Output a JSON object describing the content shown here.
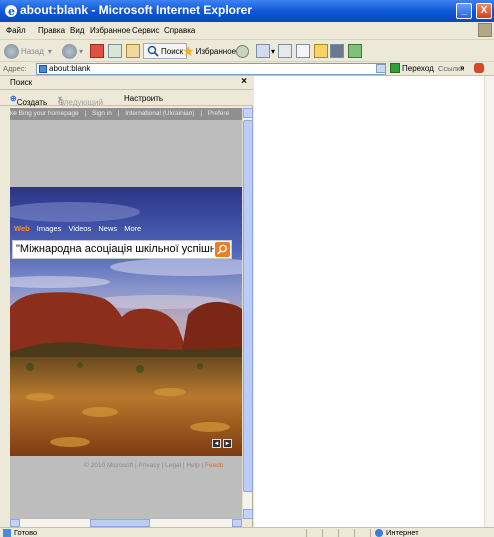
{
  "window": {
    "title": "about:blank - Microsoft Internet Explorer",
    "controls": {
      "minimize": "_",
      "maximize": "□",
      "close": "X"
    }
  },
  "menu": [
    "Файл",
    "Правка",
    "Вид",
    "Избранное",
    "Сервис",
    "Справка"
  ],
  "toolbar": {
    "back_label": "Назад",
    "search_label": "Поиск",
    "favorites_label": "Избранное",
    "icons": [
      "back-icon",
      "forward-icon",
      "stop-icon",
      "refresh-icon",
      "home-icon",
      "search-icon",
      "favorites-icon",
      "history-icon",
      "mail-icon",
      "print-icon",
      "edit-icon",
      "folder-icon",
      "messenger-icon"
    ]
  },
  "address": {
    "label": "Адрес:",
    "value": "about:blank",
    "go_label": "Переход",
    "links_label": "Ссылки",
    "chevron": "»"
  },
  "search_pane": {
    "title": "Поиск",
    "close": "×",
    "create_label": "Создать",
    "next_label": "Следующий",
    "customize_label": "Настроить",
    "bing": {
      "top_links": [
        "ke Bing your homepage",
        "|",
        "Sign in",
        "|",
        "International (Ukrainian)",
        "|",
        "Prefere"
      ],
      "nav": [
        "Web",
        "Images",
        "Videos",
        "News",
        "More"
      ],
      "query": "\"Міжнародна асоціація шкільної успішнос",
      "image_controls": [
        "◄",
        "►"
      ],
      "footer_prefix": "© 2010 Microsoft | Privacy | Legal | Help |",
      "footer_feed": "Feedb"
    }
  },
  "status": {
    "text": "Готово",
    "zone": "Интернет"
  },
  "colors": {
    "titlebar": "#0b55d6",
    "chrome": "#ece9d8",
    "bing_accent": "#f07d1d",
    "sky": "#3b4fa8",
    "rock": "#8c2e1c"
  }
}
